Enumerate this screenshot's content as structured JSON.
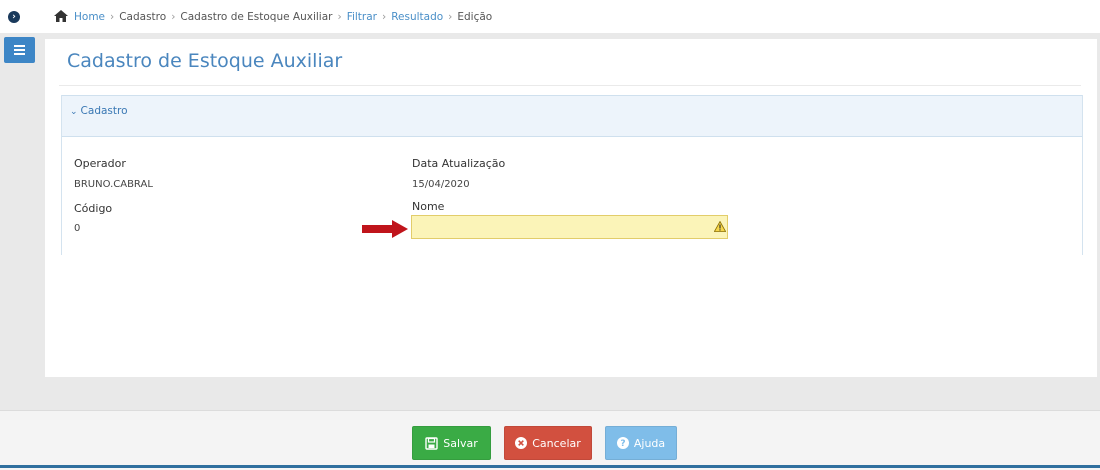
{
  "breadcrumb": {
    "home": "Home",
    "items": [
      "Cadastro",
      "Cadastro de Estoque Auxiliar",
      "Filtrar",
      "Resultado",
      "Edição"
    ]
  },
  "page": {
    "title": "Cadastro de Estoque Auxiliar"
  },
  "panel": {
    "title": "Cadastro"
  },
  "fields": {
    "operador_label": "Operador",
    "operador_value": "BRUNO.CABRAL",
    "data_label": "Data Atualização",
    "data_value": "15/04/2020",
    "codigo_label": "Código",
    "codigo_value": "0",
    "nome_label": "Nome",
    "nome_value": ""
  },
  "actions": {
    "save": "Salvar",
    "cancel": "Cancelar",
    "help": "Ajuda"
  },
  "colors": {
    "save": "#3aab45",
    "cancel": "#d2503f",
    "help": "#7fbde9",
    "arrow": "#c0141b",
    "nome_input_bg": "#fbf4b8"
  }
}
